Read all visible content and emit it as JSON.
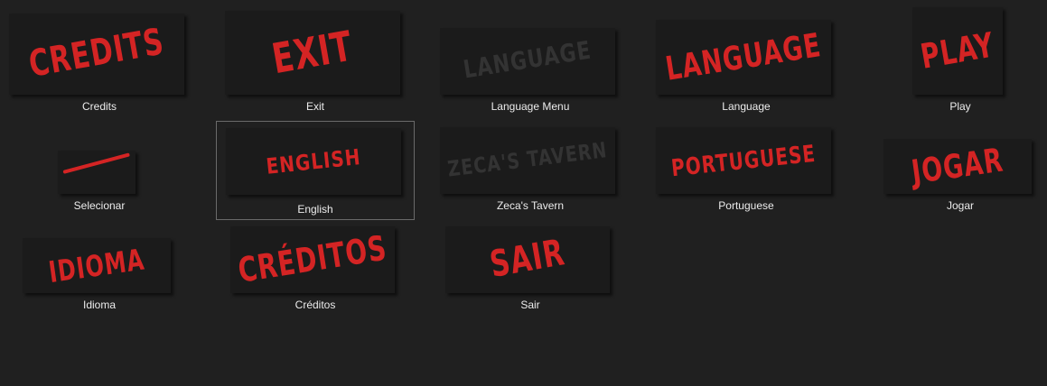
{
  "colors": {
    "background": "#202020",
    "thumb": "#1b1b1b",
    "accent_red": "#d42424",
    "label_text": "#ececec"
  },
  "assets": [
    {
      "label": "Credits",
      "thumb_text": "CREDITS"
    },
    {
      "label": "Exit",
      "thumb_text": "EXIT"
    },
    {
      "label": "Language Menu",
      "thumb_text": "LANGUAGE"
    },
    {
      "label": "Language",
      "thumb_text": "LANGUAGE"
    },
    {
      "label": "Play",
      "thumb_text": "PLAY"
    },
    {
      "label": "Selecionar",
      "thumb_text": ""
    },
    {
      "label": "English",
      "thumb_text": "ENGLISH",
      "selected": true
    },
    {
      "label": "Zeca's Tavern",
      "thumb_text": "ZECA'S TAVERN"
    },
    {
      "label": "Portuguese",
      "thumb_text": "PORTUGUESE"
    },
    {
      "label": "Jogar",
      "thumb_text": "JOGAR"
    },
    {
      "label": "Idioma",
      "thumb_text": "IDIOMA"
    },
    {
      "label": "Créditos",
      "thumb_text": "CRÉDITOS"
    },
    {
      "label": "Sair",
      "thumb_text": "SAIR"
    }
  ]
}
